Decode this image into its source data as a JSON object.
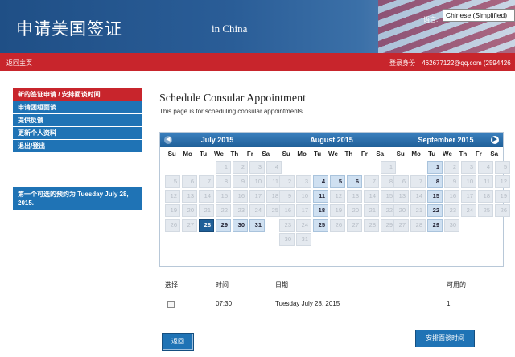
{
  "header": {
    "logo": "申请美国签证",
    "subtitle": "in China",
    "language_label": "语言:",
    "language_value": "Chinese (Simplified)"
  },
  "topbar": {
    "home": "返回主页",
    "login_label": "登录身份",
    "login_user": "462677122@qq.com (2594426"
  },
  "sidebar": {
    "items": [
      {
        "label": "新的签证申请 / 安排面谈时间",
        "active": true
      },
      {
        "label": "申请团组面谈"
      },
      {
        "label": "提供反馈"
      },
      {
        "label": "更新个人资料"
      },
      {
        "label": "退出/登出"
      }
    ],
    "first_available": "第一个可选的预约为 Tuesday July 28, 2015."
  },
  "main": {
    "title": "Schedule Consular Appointment",
    "subtitle": "This page is for scheduling consular appointments."
  },
  "calendar": {
    "dows": [
      "Su",
      "Mo",
      "Tu",
      "We",
      "Th",
      "Fr",
      "Sa"
    ],
    "months": [
      {
        "title": "July 2015",
        "start": 3,
        "days": 31,
        "available": [
          28,
          29,
          30,
          31
        ],
        "selected": 28
      },
      {
        "title": "August 2015",
        "start": 6,
        "days": 31,
        "available": [
          4,
          5,
          6,
          11,
          18,
          25
        ],
        "selected": null
      },
      {
        "title": "September 2015",
        "start": 2,
        "days": 30,
        "available": [
          1,
          8,
          15,
          22,
          29
        ],
        "selected": null
      }
    ]
  },
  "table": {
    "headers": {
      "select": "选择",
      "time": "时间",
      "date": "日期",
      "available": "可用的"
    },
    "row": {
      "time": "07:30",
      "date": "Tuesday July 28, 2015",
      "available": "1"
    }
  },
  "buttons": {
    "back": "返回",
    "schedule": "安排面谈时间"
  },
  "colors": {
    "primary_blue": "#1f73b5",
    "red_bar": "#c8252c",
    "selected_day": "#1f5f98"
  }
}
